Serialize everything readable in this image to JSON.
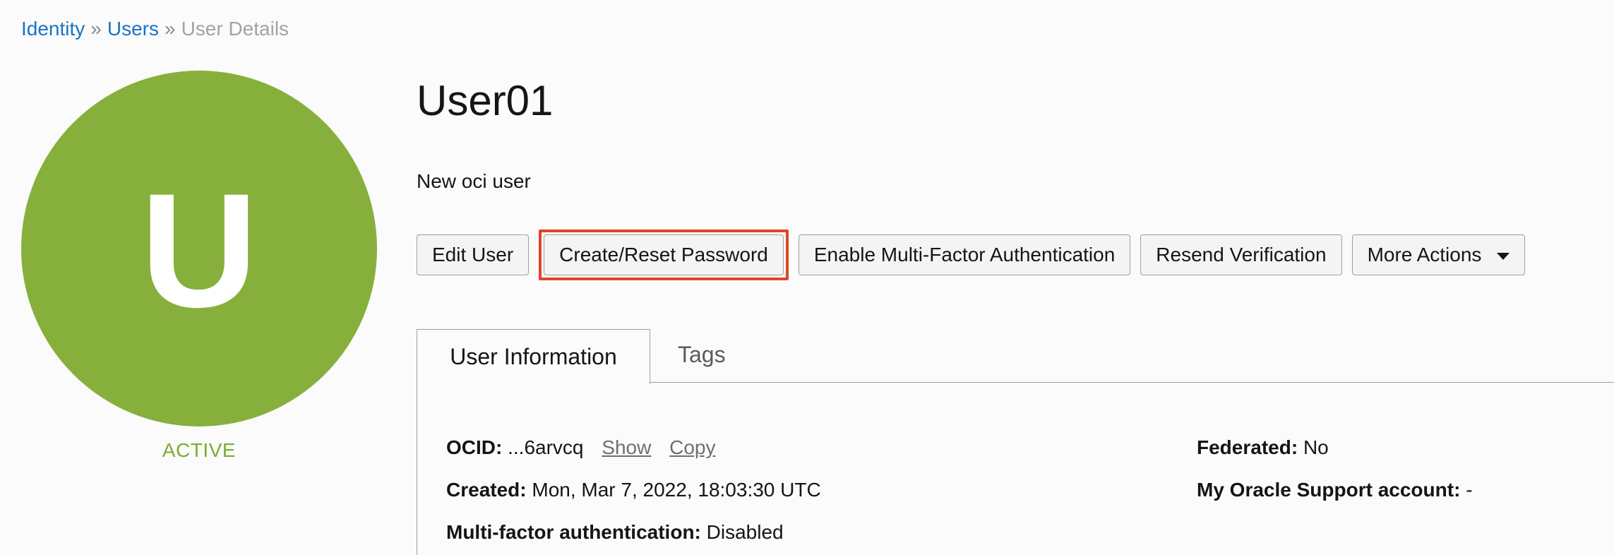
{
  "breadcrumb": {
    "items": [
      "Identity",
      "Users"
    ],
    "separator": "»",
    "current": "User Details"
  },
  "avatar": {
    "letter": "U",
    "color": "#86b03b",
    "status": "ACTIVE"
  },
  "user": {
    "name": "User01",
    "description": "New oci user"
  },
  "actions": {
    "edit": "Edit User",
    "reset_password": "Create/Reset Password",
    "enable_mfa": "Enable Multi-Factor Authentication",
    "resend": "Resend Verification",
    "more": "More Actions"
  },
  "tabs": {
    "active": "User Information",
    "other": "Tags"
  },
  "info": {
    "ocid": {
      "label": "OCID:",
      "value": "...6arvcq",
      "show": "Show",
      "copy": "Copy"
    },
    "created": {
      "label": "Created:",
      "value": "Mon, Mar 7, 2022, 18:03:30 UTC"
    },
    "mfa": {
      "label": "Multi-factor authentication:",
      "value": "Disabled"
    },
    "federated": {
      "label": "Federated:",
      "value": "No"
    },
    "support": {
      "label": "My Oracle Support account:",
      "value": "-"
    }
  },
  "colors": {
    "link": "#1a73c7",
    "highlight": "#e0452c",
    "status": "#7dad2e"
  }
}
